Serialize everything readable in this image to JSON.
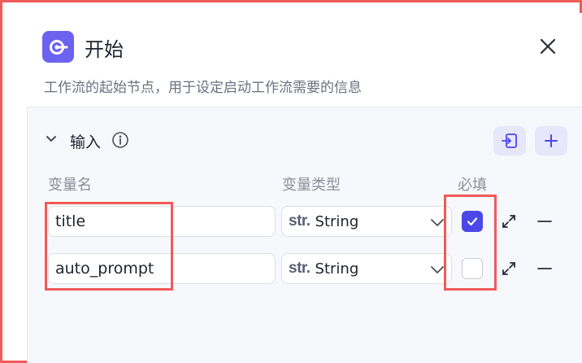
{
  "header": {
    "title": "开始",
    "description": "工作流的起始节点，用于设定启动工作流需要的信息",
    "icon": "start-node-icon"
  },
  "section": {
    "title": "输入",
    "info_icon": "info-icon",
    "actions": [
      "import-icon",
      "plus-icon"
    ]
  },
  "table": {
    "columns": [
      "变量名",
      "变量类型",
      "必填"
    ],
    "rows": [
      {
        "name": "title",
        "type_prefix": "str.",
        "type": "String",
        "required": true
      },
      {
        "name": "auto_prompt",
        "type_prefix": "str.",
        "type": "String",
        "required": false
      }
    ]
  },
  "colors": {
    "accent": "#4b47e8",
    "brand": "#6b63f0",
    "highlight": "#f05a5a"
  }
}
